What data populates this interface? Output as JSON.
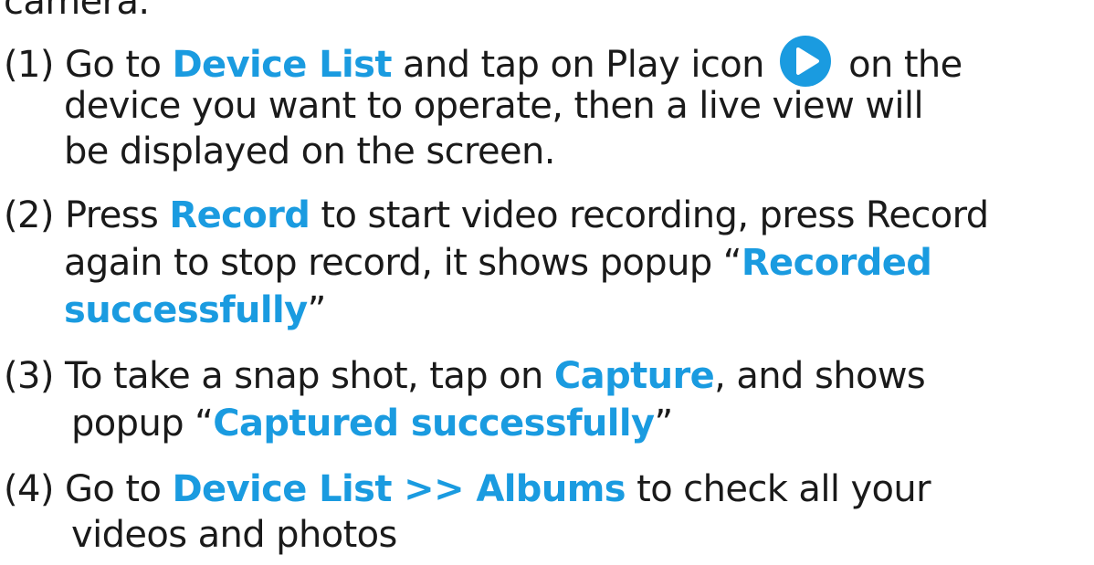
{
  "colors": {
    "highlight": "#1a9be0",
    "text": "#1a1a1a",
    "play_icon": "#1a9be0"
  },
  "intro": {
    "text": "camera."
  },
  "steps": [
    {
      "l1": {
        "prefix": "(1) Go to ",
        "hl": "Device List",
        "mid": " and tap on Play icon",
        "icon": "play-circle-icon",
        "suffix": "on the"
      },
      "l2": "device you want to operate, then a live view will",
      "l3": "be displayed on the screen."
    },
    {
      "l1": {
        "prefix": "(2) Press ",
        "hl": "Record",
        "rest": " to start video recording, press Record"
      },
      "l2": {
        "text": "again to stop record, it shows popup “",
        "hl": "Recorded"
      },
      "l3": {
        "hl": "successfully",
        "rest": "”"
      }
    },
    {
      "l1": {
        "prefix": "(3) To take a snap shot, tap on ",
        "hl": "Capture",
        "rest": ", and shows"
      },
      "l2": {
        "text": "popup “",
        "hl": "Captured successfully",
        "rest": "”"
      }
    },
    {
      "l1": {
        "prefix": "(4) Go to ",
        "hl": "Device List >> Albums",
        "rest": " to check all your"
      },
      "l2": "videos and photos"
    }
  ]
}
